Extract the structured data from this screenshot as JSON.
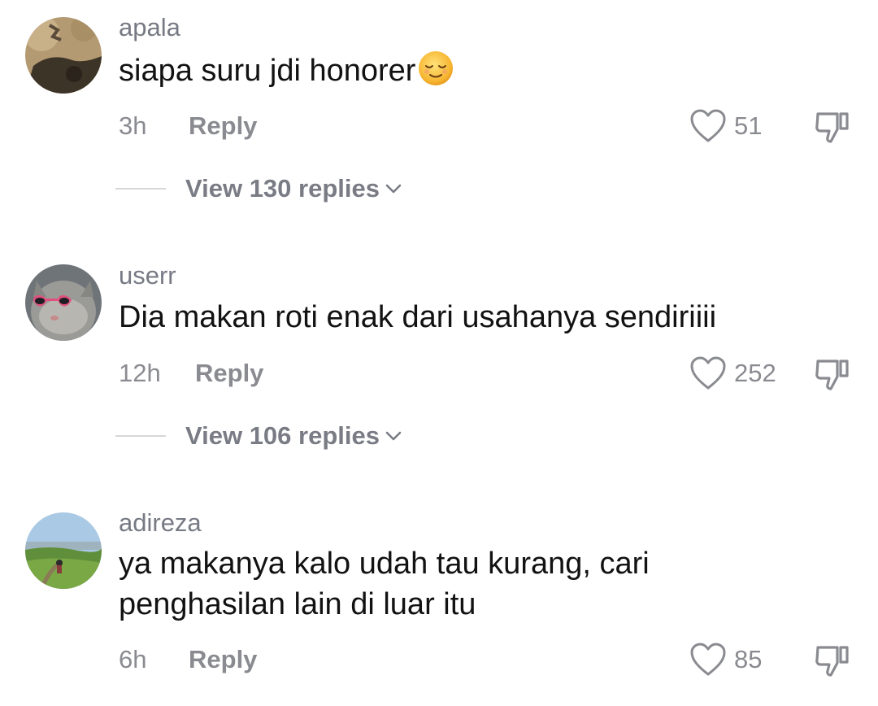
{
  "comments": [
    {
      "username": "apala",
      "text": "siapa suru jdi honorer",
      "emoji": "relieved-face-emoji",
      "time": "3h",
      "reply_label": "Reply",
      "likes": "51",
      "view_replies": "View 130 replies"
    },
    {
      "username": "userr",
      "text": "Dia makan roti enak dari usahanya sendiriiii",
      "time": "12h",
      "reply_label": "Reply",
      "likes": "252",
      "view_replies": "View 106 replies"
    },
    {
      "username": "adireza",
      "text": "ya makanya kalo udah tau kurang, cari penghasilan lain di luar itu",
      "time": "6h",
      "reply_label": "Reply",
      "likes": "85"
    }
  ],
  "icons": {
    "like": "heart-outline-icon",
    "dislike": "thumbs-down-outline-icon",
    "expand": "chevron-down-icon"
  },
  "colors": {
    "secondary_text": "#8a8b91",
    "primary_text": "#121212",
    "divider": "#d7d7d9"
  }
}
